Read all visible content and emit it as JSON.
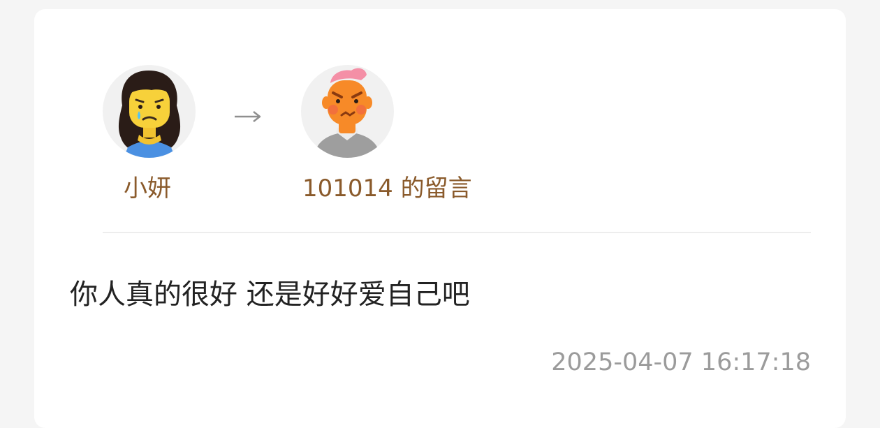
{
  "sender": {
    "name": "小妍",
    "avatar_icon": "crying-woman-avatar-icon"
  },
  "direction_icon": "arrow-right-icon",
  "recipient": {
    "label": "101014 的留言",
    "avatar_icon": "angry-man-avatar-icon"
  },
  "message": {
    "text": "你人真的很好 还是好好爱自己吧",
    "timestamp": "2025-04-07 16:17:18"
  },
  "colors": {
    "name_accent": "#8a5a2b",
    "text_primary": "#222222",
    "text_secondary": "#9b9b9b",
    "card_bg": "#ffffff",
    "page_bg": "#f5f5f5"
  }
}
